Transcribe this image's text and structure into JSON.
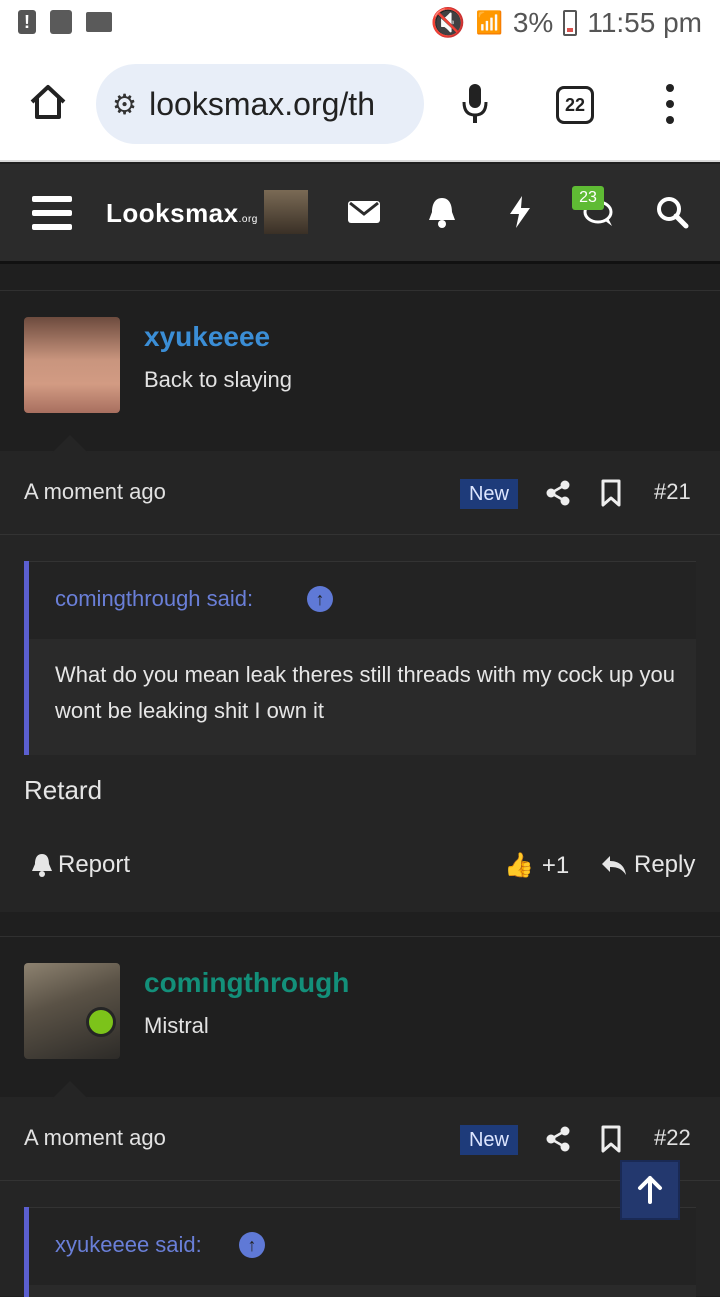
{
  "statusbar": {
    "battery": "3%",
    "time": "11:55 pm"
  },
  "browser": {
    "url": "looksmax.org/th",
    "tab_count": "22"
  },
  "site": {
    "logo_main": "Looksmax",
    "logo_suffix": ".org",
    "messages_badge": "23"
  },
  "posts": [
    {
      "username": "xyukeeee",
      "usertitle": "Back to slaying",
      "time": "A moment ago",
      "badge": "New",
      "number": "#21",
      "quote_author": "comingthrough said:",
      "quote_text": "What do you mean leak theres still threads with my cock up you wont be leaking shit I own it",
      "message": "Retard",
      "report_label": "Report",
      "like_count": "+1",
      "reply_label": "Reply"
    },
    {
      "username": "comingthrough",
      "usertitle": "Mistral",
      "time": "A moment ago",
      "badge": "New",
      "number": "#22",
      "quote_author": "xyukeeee said:"
    }
  ],
  "colors": {
    "accent_blue": "#3b8ed6",
    "accent_teal": "#13907a",
    "badge_bg": "#1e3b7a",
    "online": "#7cc31a",
    "quote_border": "#5b5fd0"
  }
}
